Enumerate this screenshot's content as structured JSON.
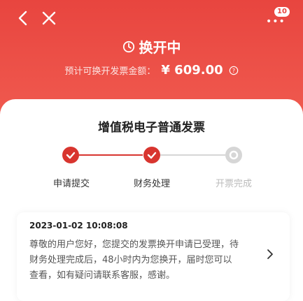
{
  "header": {
    "badge_count": "10",
    "status": "换开中",
    "amount_label": "预计可换开发票金额：",
    "amount_value": "¥ 609.00"
  },
  "invoice": {
    "type": "增值税电子普通发票"
  },
  "steps": [
    {
      "label": "申请提交",
      "state": "done"
    },
    {
      "label": "财务处理",
      "state": "done"
    },
    {
      "label": "开票完成",
      "state": "pending"
    }
  ],
  "message": {
    "time": "2023-01-02 10:08:08",
    "body": "尊敬的用户您好，您提交的发票换开申请已受理，待财务处理完成后，48小时内为您换开，届时您可以查看，如有疑问请联系客服，感谢。"
  },
  "colors": {
    "brand": "#e8453f",
    "done": "#d8352f",
    "pending": "#d6d6d6"
  },
  "icons": {
    "back": "back-arrow-icon",
    "close": "close-icon",
    "more": "more-dots-icon",
    "clock": "clock-icon",
    "info": "info-icon",
    "check": "check-icon",
    "chevron": "chevron-right-icon"
  }
}
